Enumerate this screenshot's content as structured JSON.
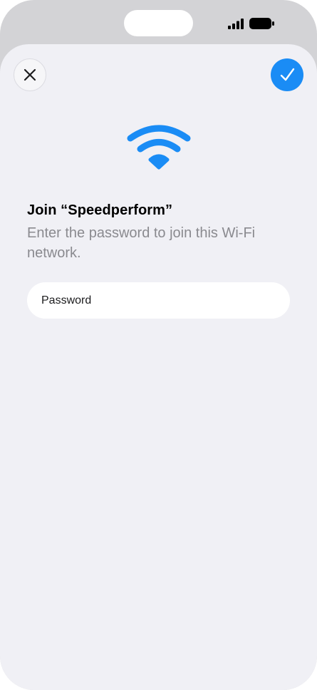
{
  "dialog": {
    "title": "Join “Speedperform”",
    "subtitle": "Enter the password to join this Wi-Fi network."
  },
  "password": {
    "placeholder": "Password",
    "value": ""
  },
  "buttons": {
    "close_icon": "close-icon",
    "confirm_icon": "checkmark-icon"
  },
  "colors": {
    "accent": "#1a8cf5",
    "wifi": "#1a8cf5",
    "sheet_background": "#f0f0f5",
    "frame_background": "#d3d3d6",
    "secondary_text": "#8a8a8f"
  }
}
